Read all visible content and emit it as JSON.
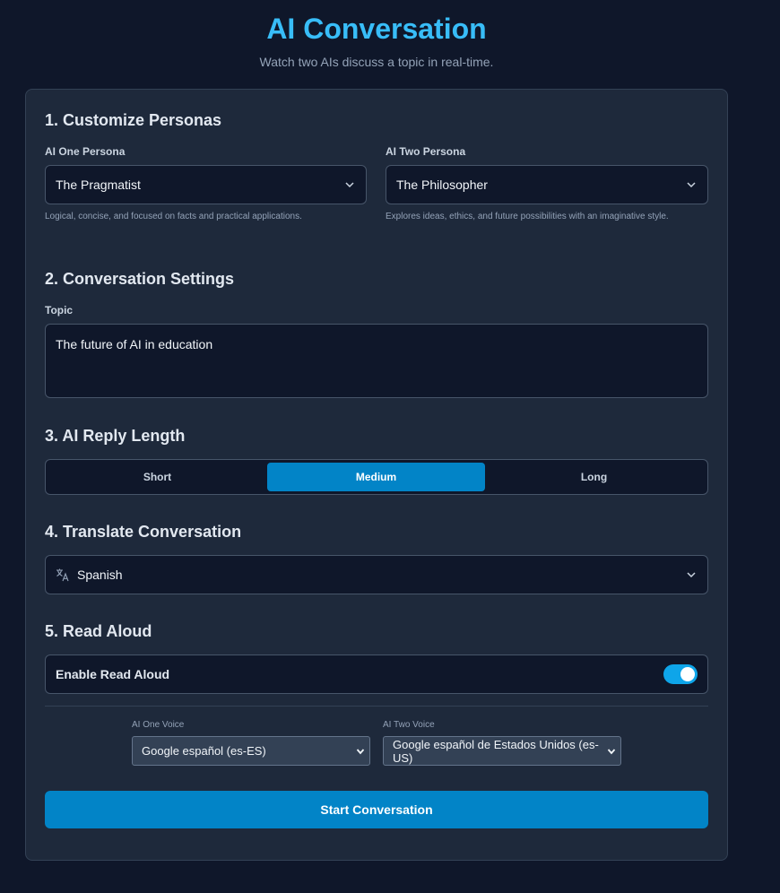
{
  "header": {
    "title": "AI Conversation",
    "subtitle": "Watch two AIs discuss a topic in real-time."
  },
  "personas": {
    "section_title": "1. Customize Personas",
    "ai_one": {
      "label": "AI One Persona",
      "value": "The Pragmatist",
      "hint": "Logical, concise, and focused on facts and practical applications."
    },
    "ai_two": {
      "label": "AI Two Persona",
      "value": "The Philosopher",
      "hint": "Explores ideas, ethics, and future possibilities with an imaginative style."
    }
  },
  "settings": {
    "section_title": "2. Conversation Settings",
    "topic_label": "Topic",
    "topic_value": "The future of AI in education"
  },
  "reply_length": {
    "section_title": "3. AI Reply Length",
    "options": [
      "Short",
      "Medium",
      "Long"
    ],
    "selected": "Medium"
  },
  "translate": {
    "section_title": "4. Translate Conversation",
    "value": "Spanish",
    "icon": "translate-icon"
  },
  "read_aloud": {
    "section_title": "5. Read Aloud",
    "toggle_label": "Enable Read Aloud",
    "enabled": true,
    "ai_one_voice_label": "AI One Voice",
    "ai_one_voice": "Google español (es-ES)",
    "ai_two_voice_label": "AI Two Voice",
    "ai_two_voice": "Google español de Estados Unidos (es-US)"
  },
  "actions": {
    "start_label": "Start Conversation"
  },
  "colors": {
    "accent": "#0284c7",
    "title": "#38bdf8",
    "background": "#0f172a",
    "card": "#1e293b"
  }
}
